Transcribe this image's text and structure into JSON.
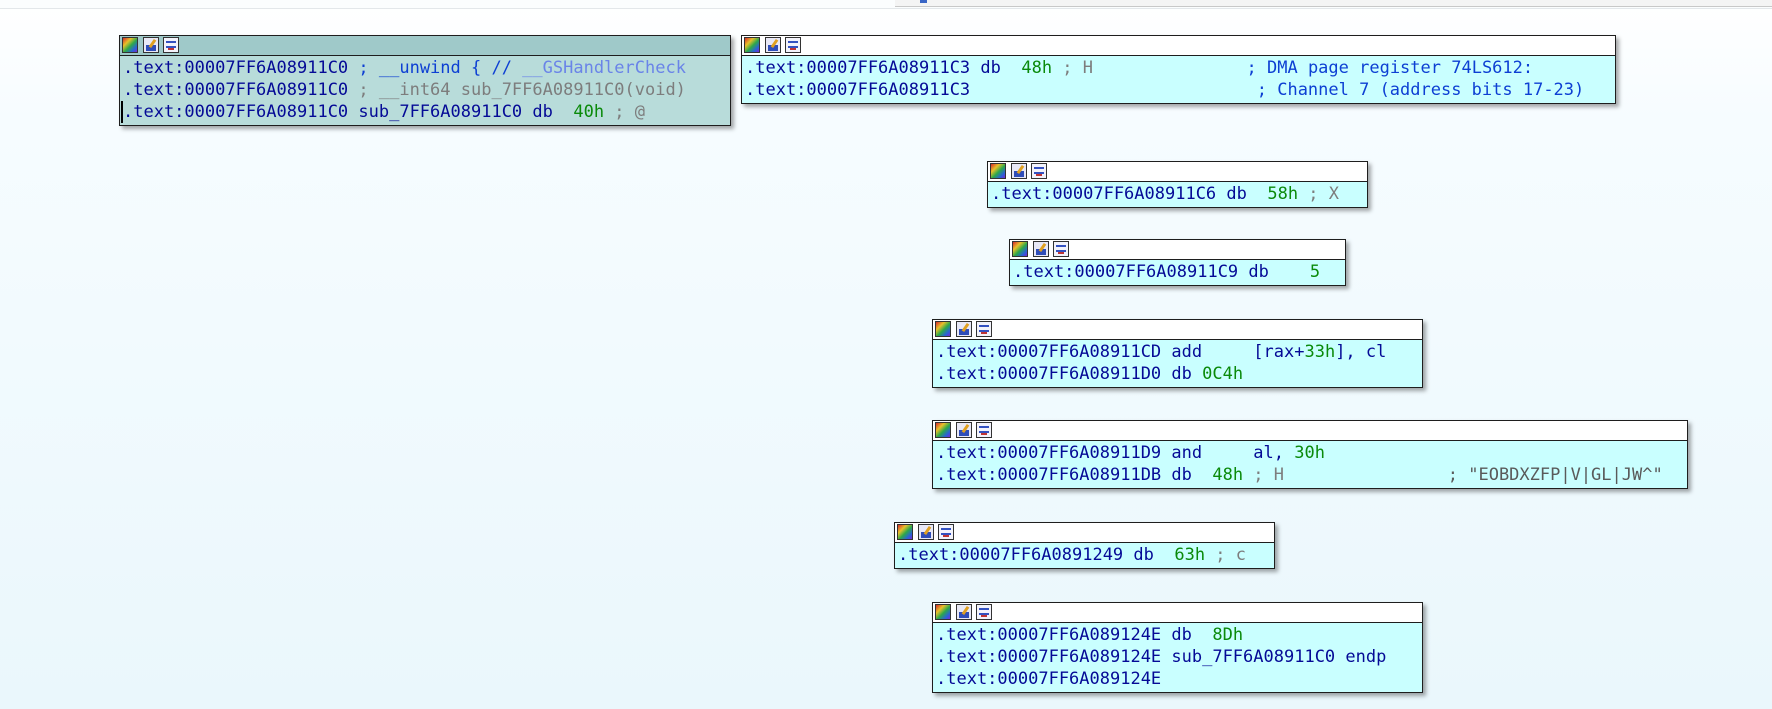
{
  "nodes": [
    {
      "id": "node-11c0",
      "selected": true,
      "lines": [
        [
          [
            ".text:00007FF6A08911C0 ",
            "addr"
          ],
          [
            "; __unwind { // ",
            "cmtb"
          ],
          [
            "__GSHandlerCheck",
            "ref"
          ]
        ],
        [
          [
            ".text:00007FF6A08911C0 ",
            "addr"
          ],
          [
            "; __int64 sub_7FF6A08911C0(void)",
            "cmt"
          ]
        ],
        [
          [
            ".text:00007FF6A08911C0 sub_7FF6A08911C0 db  ",
            "addr"
          ],
          [
            "40h",
            "num"
          ],
          [
            " ; @",
            "cmt"
          ]
        ]
      ]
    },
    {
      "id": "node-11c3",
      "selected": false,
      "lines": [
        [
          [
            ".text:00007FF6A08911C3 db  ",
            "addr"
          ],
          [
            "48h",
            "num"
          ],
          [
            " ; H",
            "cmt"
          ],
          [
            "               ; DMA page register 74LS612:",
            "cmtb"
          ]
        ],
        [
          [
            ".text:00007FF6A08911C3",
            "addr"
          ],
          [
            "                            ; Channel 7 (address bits 17-23)",
            "cmtb"
          ]
        ]
      ]
    },
    {
      "id": "node-11c6",
      "selected": false,
      "lines": [
        [
          [
            ".text:00007FF6A08911C6 db  ",
            "addr"
          ],
          [
            "58h",
            "num"
          ],
          [
            " ; X",
            "cmt"
          ]
        ]
      ]
    },
    {
      "id": "node-11c9",
      "selected": false,
      "lines": [
        [
          [
            ".text:00007FF6A08911C9 db    ",
            "addr"
          ],
          [
            "5",
            "num"
          ]
        ]
      ]
    },
    {
      "id": "node-11cd",
      "selected": false,
      "lines": [
        [
          [
            ".text:00007FF6A08911CD add     [rax+",
            "addr"
          ],
          [
            "33h",
            "num"
          ],
          [
            "], cl",
            "addr"
          ]
        ],
        [
          [
            ".text:00007FF6A08911D0 db ",
            "addr"
          ],
          [
            "0C4h",
            "num"
          ]
        ]
      ]
    },
    {
      "id": "node-11d9",
      "selected": false,
      "lines": [
        [
          [
            ".text:00007FF6A08911D9 and     al, ",
            "addr"
          ],
          [
            "30h",
            "num"
          ]
        ],
        [
          [
            ".text:00007FF6A08911DB db  ",
            "addr"
          ],
          [
            "48h",
            "num"
          ],
          [
            " ; H",
            "cmt"
          ],
          [
            "                ; \"EOBDXZFP|V|GL|JW^\"",
            "strcmt"
          ]
        ]
      ]
    },
    {
      "id": "node-1249",
      "selected": false,
      "lines": [
        [
          [
            ".text:00007FF6A0891249 db  ",
            "addr"
          ],
          [
            "63h",
            "num"
          ],
          [
            " ; c",
            "cmt"
          ]
        ]
      ]
    },
    {
      "id": "node-124e",
      "selected": false,
      "lines": [
        [
          [
            ".text:00007FF6A089124E db  ",
            "addr"
          ],
          [
            "8Dh",
            "num"
          ]
        ],
        [
          [
            ".text:00007FF6A089124E sub_7FF6A08911C0 endp",
            "addr"
          ]
        ],
        [
          [
            ".text:00007FF6A089124E",
            "addr"
          ]
        ]
      ]
    }
  ]
}
